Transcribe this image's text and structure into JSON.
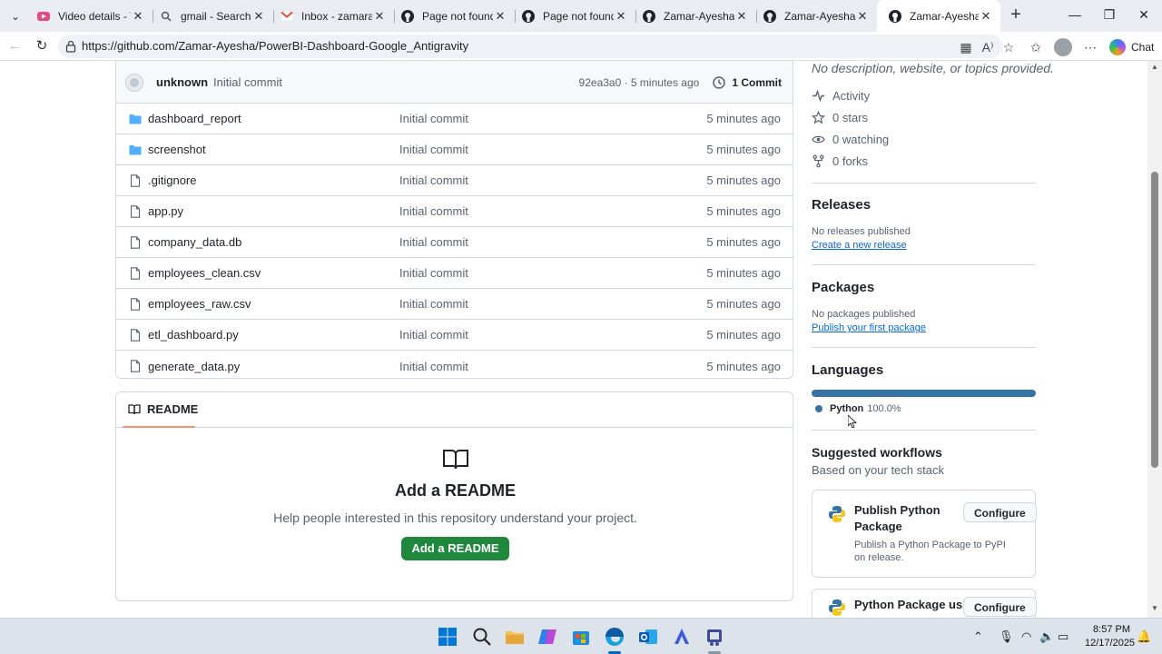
{
  "browser": {
    "tabs": [
      {
        "title": "Video details - YouTube",
        "icon": "youtube-studio-icon"
      },
      {
        "title": "gmail - Search",
        "icon": "search-icon"
      },
      {
        "title": "Inbox - zamarayesha",
        "icon": "gmail-icon"
      },
      {
        "title": "Page not found · GitHub",
        "icon": "github-icon"
      },
      {
        "title": "Page not found · GitHub",
        "icon": "github-icon"
      },
      {
        "title": "Zamar-Ayesha/PowerBI",
        "icon": "github-icon"
      },
      {
        "title": "Zamar-Ayesha/PowerBI",
        "icon": "github-icon"
      },
      {
        "title": "Zamar-Ayesha/PowerBI",
        "icon": "github-icon",
        "active": true
      }
    ],
    "url": "https://github.com/Zamar-Ayesha/PowerBI-Dashboard-Google_Antigravity",
    "chat_label": "Chat"
  },
  "repo": {
    "latest_commit": {
      "author": "unknown",
      "message": "Initial commit",
      "hash_time": "92ea3a0 · 5 minutes ago",
      "count_label": "1 Commit"
    },
    "files": [
      {
        "name": "dashboard_report",
        "type": "folder",
        "message": "Initial commit",
        "time": "5 minutes ago"
      },
      {
        "name": "screenshot",
        "type": "folder",
        "message": "Initial commit",
        "time": "5 minutes ago"
      },
      {
        "name": ".gitignore",
        "type": "file",
        "message": "Initial commit",
        "time": "5 minutes ago"
      },
      {
        "name": "app.py",
        "type": "file",
        "message": "Initial commit",
        "time": "5 minutes ago"
      },
      {
        "name": "company_data.db",
        "type": "file",
        "message": "Initial commit",
        "time": "5 minutes ago"
      },
      {
        "name": "employees_clean.csv",
        "type": "file",
        "message": "Initial commit",
        "time": "5 minutes ago"
      },
      {
        "name": "employees_raw.csv",
        "type": "file",
        "message": "Initial commit",
        "time": "5 minutes ago"
      },
      {
        "name": "etl_dashboard.py",
        "type": "file",
        "message": "Initial commit",
        "time": "5 minutes ago"
      },
      {
        "name": "generate_data.py",
        "type": "file",
        "message": "Initial commit",
        "time": "5 minutes ago"
      }
    ],
    "readme": {
      "tab_label": "README",
      "title": "Add a README",
      "description": "Help people interested in this repository understand your project.",
      "button": "Add a README"
    }
  },
  "sidebar": {
    "about_text": "No description, website, or topics provided.",
    "activity": "Activity",
    "stars": "0 stars",
    "watching": "0 watching",
    "forks": "0 forks",
    "releases": {
      "heading": "Releases",
      "empty": "No releases published",
      "link": "Create a new release"
    },
    "packages": {
      "heading": "Packages",
      "empty": "No packages published",
      "link": "Publish your first package"
    },
    "languages": {
      "heading": "Languages",
      "items": [
        {
          "name": "Python",
          "percent": "100.0%",
          "color": "#3572a5"
        }
      ]
    },
    "workflows": {
      "heading": "Suggested workflows",
      "subheading": "Based on your tech stack",
      "items": [
        {
          "title": "Publish Python Package",
          "description": "Publish a Python Package to PyPI on release.",
          "button": "Configure"
        },
        {
          "title": "Python Package using",
          "description": "",
          "button": "Configure"
        }
      ]
    }
  },
  "taskbar": {
    "time": "8:57 PM",
    "date": "12/17/2025"
  },
  "colors": {
    "accent_green": "#1f883d",
    "link_blue": "#0969da",
    "folder_blue": "#54aeff"
  }
}
